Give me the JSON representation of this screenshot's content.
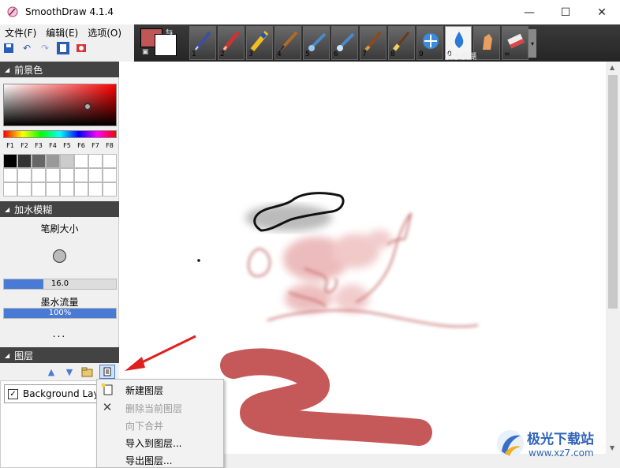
{
  "window": {
    "title": "SmoothDraw 4.1.4"
  },
  "menu": [
    "文件(F)",
    "编辑(E)",
    "选项(O)"
  ],
  "toolbar": {
    "brush_numbers": [
      "1",
      "2",
      "3",
      "4",
      "5",
      "6",
      "7",
      "8",
      "9",
      "0",
      "-",
      "="
    ],
    "active_brush_caption": "加水模糊",
    "foreground_color": "#c05656",
    "background_color": "#ffffff"
  },
  "panels": {
    "foreground": {
      "title": "前景色",
      "function_keys": [
        "F1",
        "F2",
        "F3",
        "F4",
        "F5",
        "F6",
        "F7",
        "F8"
      ],
      "palette_row1": [
        "#000000",
        "#333333",
        "#666666",
        "#999999",
        "#cccccc",
        "#ffffff",
        "#ffffff",
        "#ffffff"
      ]
    },
    "brush": {
      "title": "加水模糊",
      "size_label": "笔刷大小",
      "size_value": "16.0",
      "size_fill": 0.35,
      "flow_label": "墨水流量",
      "flow_value": "100%",
      "flow_fill": 1.0,
      "more": "..."
    },
    "layers": {
      "title": "图层",
      "items": [
        {
          "name": "Background Layer",
          "visible": "✓"
        }
      ]
    }
  },
  "context_menu": {
    "new_layer": "新建图层",
    "delete_layer": "删除当前图层",
    "merge_down": "向下合并",
    "import_to_layer": "导入到图层...",
    "export_layer": "导出图层..."
  },
  "watermark": {
    "title": "极光下载站",
    "url": "www.xz7.com"
  }
}
